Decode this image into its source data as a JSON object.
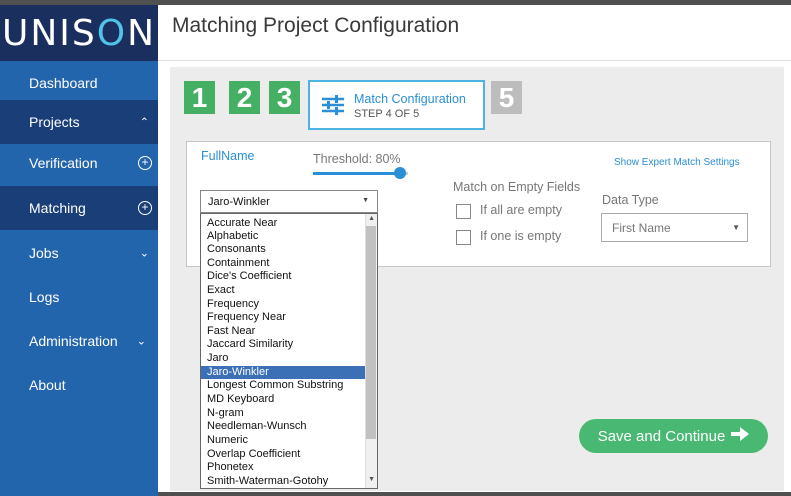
{
  "app": {
    "logo": "UNIS",
    "logo_o": "O",
    "logo_n": "N",
    "title": "Matching Project Configuration"
  },
  "sidebar": {
    "items": [
      {
        "label": "Dashboard",
        "icon": "",
        "active": false
      },
      {
        "label": "Projects",
        "icon": "chevron-up",
        "active": true
      },
      {
        "label": "Verification",
        "icon": "plus-circle",
        "active": false
      },
      {
        "label": "Matching",
        "icon": "plus-circle",
        "active": true
      },
      {
        "label": "Jobs",
        "icon": "chevron-down",
        "active": false
      },
      {
        "label": "Logs",
        "icon": "",
        "active": false
      },
      {
        "label": "Administration",
        "icon": "chevron-down",
        "active": false
      },
      {
        "label": "About",
        "icon": "",
        "active": false
      }
    ]
  },
  "steps": {
    "done": [
      "1",
      "2",
      "3"
    ],
    "current_label": "Match Configuration",
    "current_sub": "STEP 4 OF 5",
    "future": "5",
    "colors": {
      "done": "#45b064",
      "future": "#bdbdbd",
      "current_border": "#4db3e0"
    }
  },
  "config": {
    "field_name": "FullName",
    "threshold_label": "Threshold: 80%",
    "threshold_value": 0.8,
    "expert_link": "Show Expert Match Settings",
    "empty_heading": "Match on Empty Fields",
    "empty_all": "If all are empty",
    "empty_one": "If one is empty",
    "data_type_label": "Data Type",
    "data_type_value": "First Name",
    "algorithm_selected": "Jaro-Winkler",
    "algorithms": [
      "Accurate Near",
      "Alphabetic",
      "Consonants",
      "Containment",
      "Dice's Coefficient",
      "Exact",
      "Frequency",
      "Frequency Near",
      "Fast Near",
      "Jaccard Similarity",
      "Jaro",
      "Jaro-Winkler",
      "Longest Common Substring",
      "MD Keyboard",
      "N-gram",
      "Needleman-Wunsch",
      "Numeric",
      "Overlap Coefficient",
      "Phonetex",
      "Smith-Waterman-Gotohy"
    ]
  },
  "actions": {
    "save_label": "Save and Continue",
    "save_icon": "arrow-right",
    "save_color": "#48b872"
  },
  "colors": {
    "sidebar": "#2365ad",
    "sidebar_active": "#1a3f78",
    "logo_bg": "#1a2f5e",
    "accent": "#2a8fd6"
  }
}
